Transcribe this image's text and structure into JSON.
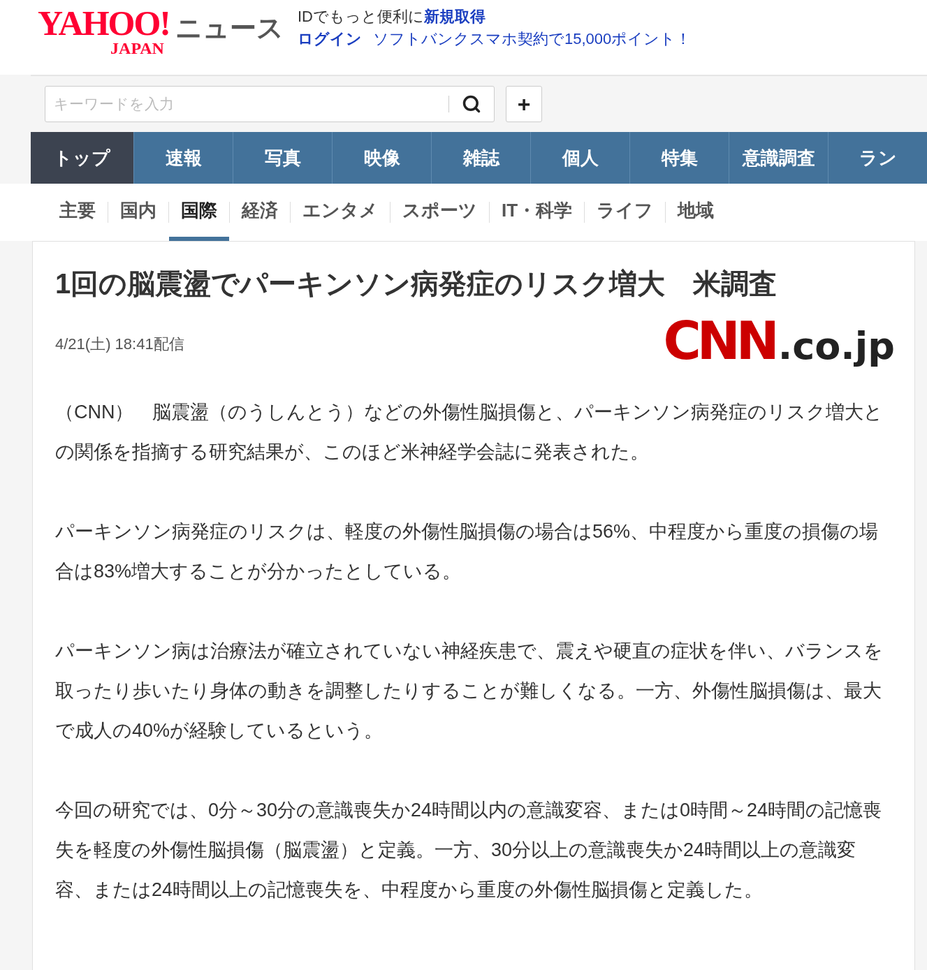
{
  "header": {
    "logo": {
      "main": "YAHOO!",
      "sub": "JAPAN"
    },
    "service": "ニュース",
    "promo_line1": {
      "text": "IDでもっと便利に",
      "link": "新規取得"
    },
    "login": "ログイン",
    "promo_line2": "ソフトバンクスマホ契約で15,000ポイント！"
  },
  "search": {
    "placeholder": "キーワードを入力",
    "add_label": "+"
  },
  "main_nav": [
    {
      "label": "トップ",
      "selected": true
    },
    {
      "label": "速報",
      "selected": false
    },
    {
      "label": "写真",
      "selected": false
    },
    {
      "label": "映像",
      "selected": false
    },
    {
      "label": "雑誌",
      "selected": false
    },
    {
      "label": "個人",
      "selected": false
    },
    {
      "label": "特集",
      "selected": false
    },
    {
      "label": "意識調査",
      "selected": false
    },
    {
      "label": "ラン",
      "selected": false
    }
  ],
  "sub_nav": [
    {
      "label": "主要",
      "selected": false
    },
    {
      "label": "国内",
      "selected": false
    },
    {
      "label": "国際",
      "selected": true
    },
    {
      "label": "経済",
      "selected": false
    },
    {
      "label": "エンタメ",
      "selected": false
    },
    {
      "label": "スポーツ",
      "selected": false
    },
    {
      "label": "IT・科学",
      "selected": false
    },
    {
      "label": "ライフ",
      "selected": false
    },
    {
      "label": "地域",
      "selected": false
    }
  ],
  "article": {
    "title": "1回の脳震盪でパーキンソン病発症のリスク増大　米調査",
    "date": "4/21(土) 18:41配信",
    "source_logo": {
      "main": "CNN",
      "sub": ".co.jp"
    },
    "paragraphs": [
      "（CNN）　脳震盪（のうしんとう）などの外傷性脳損傷と、パーキンソン病発症のリスク増大との関係を指摘する研究結果が、このほど米神経学会誌に発表された。",
      "パーキンソン病発症のリスクは、軽度の外傷性脳損傷の場合は56%、中程度から重度の損傷の場合は83%増大することが分かったとしている。",
      "パーキンソン病は治療法が確立されていない神経疾患で、震えや硬直の症状を伴い、バランスを取ったり歩いたり身体の動きを調整したりすることが難しくなる。一方、外傷性脳損傷は、最大で成人の40%が経験しているという。",
      "今回の研究では、0分～30分の意識喪失か24時間以内の意識変容、または0時間～24時間の記憶喪失を軽度の外傷性脳損傷（脳震盪）と定義。一方、30分以上の意識喪失か24時間以上の意識変容、または24時間以上の記憶喪失を、中程度から重度の外傷性脳損傷と定義した。"
    ]
  }
}
